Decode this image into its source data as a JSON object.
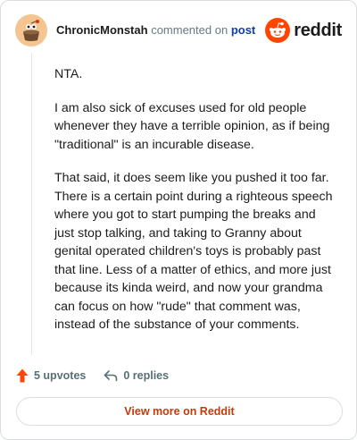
{
  "header": {
    "author": "ChronicMonstah",
    "commented_on_text": "commented on",
    "post_link_text": "post",
    "brand_name": "reddit"
  },
  "comment": {
    "paragraphs": [
      "NTA.",
      "I am also sick of excuses used for old people whenever they have a terrible opinion, as if being \"traditional\" is an incurable disease.",
      "That said, it does seem like you pushed it too far. There is a certain point during a righteous speech where you got to start pumping the breaks and just stop talking, and taking to Granny about genital operated children's toys is probably past that line. Less of a matter of ethics, and more just because its kinda weird, and now your grandma can focus on how \"rude\" that comment was, instead of the substance of your comments."
    ]
  },
  "actions": {
    "upvotes_label": "5 upvotes",
    "replies_label": "0 replies"
  },
  "footer": {
    "view_more_label": "View more on Reddit"
  },
  "colors": {
    "reddit_orange": "#ff4500",
    "link_blue": "#0f3fa8",
    "view_more_text": "#c43a08"
  },
  "icons": {
    "avatar": "avatar-icon",
    "brand": "reddit-logo-icon",
    "upvote": "upvote-arrow-icon",
    "reply": "reply-arrow-icon"
  }
}
